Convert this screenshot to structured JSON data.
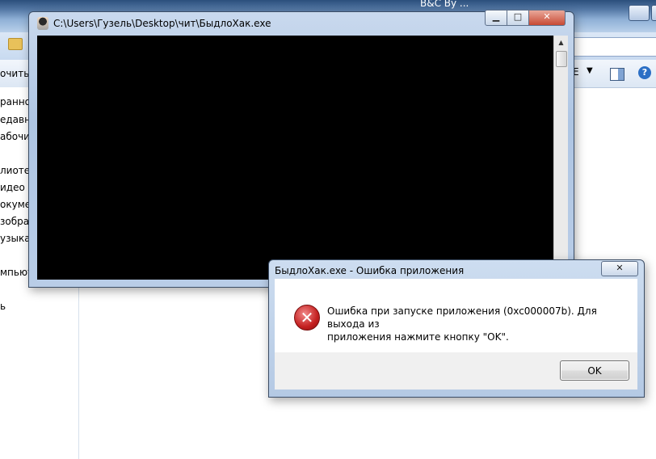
{
  "explorer": {
    "title_fragment": "B&C By ...",
    "toolbar": {
      "organize_label": "очить",
      "view_label": "E",
      "view_arrow": "▼",
      "help_label": "?"
    },
    "nav_items": [
      "ранно",
      "едавни",
      "абочий",
      "лиотек",
      "идео",
      "окумен",
      "зображ",
      "узыка",
      "мпьюте",
      "ь"
    ]
  },
  "console": {
    "title": "C:\\Users\\Гузель\\Desktop\\чит\\БыдлоХак.exe",
    "min_label": "▁",
    "max_label": "□",
    "close_label": "✕",
    "scroll_up_label": "▲"
  },
  "dialog": {
    "title": "БыдлоХак.exe - Ошибка приложения",
    "close_label": "✕",
    "icon_glyph": "✕",
    "message_line1": "Ошибка при запуске приложения (0xc000007b). Для выхода из",
    "message_line2": "приложения нажмите кнопку \"OK\".",
    "ok_label": "OK"
  }
}
